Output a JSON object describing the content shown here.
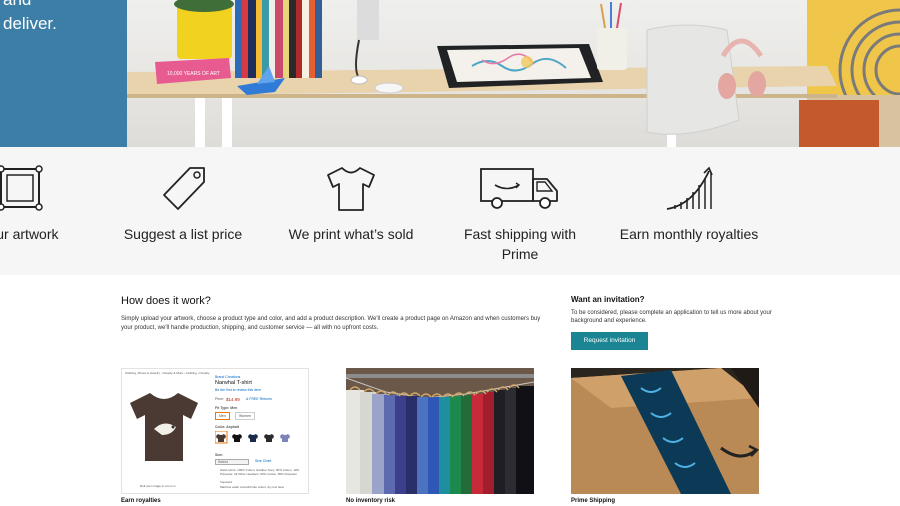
{
  "hero": {
    "text_lines": [
      "and",
      "deliver."
    ],
    "book_label": "10,000 YEARS OF ART"
  },
  "steps": [
    {
      "label": "your artwork",
      "icon": "frame-icon"
    },
    {
      "label": "Suggest a list price",
      "icon": "price-tag-icon"
    },
    {
      "label": "We print what’s sold",
      "icon": "tshirt-icon"
    },
    {
      "label_lines": [
        "Fast shipping with",
        "Prime"
      ],
      "icon": "delivery-truck-icon"
    },
    {
      "label": "Earn monthly royalties",
      "icon": "growth-chart-icon"
    }
  ],
  "how": {
    "title": "How does it work?",
    "description": "Simply upload your artwork, choose a product type and color, and add a product description. We'll create a product page on Amazon and when customers buy your product, we'll handle production, shipping, and customer service — all with no upfront costs."
  },
  "invitation": {
    "title": "Want an invitation?",
    "description": "To be considered, please complete an application to tell us more about your background and experience.",
    "button_label": "Request invitation"
  },
  "cards": [
    {
      "caption": "Earn royalties"
    },
    {
      "caption": "No inventory risk"
    },
    {
      "caption": "Prime Shipping"
    }
  ],
  "product_mock": {
    "breadcrumb": "Clothing, Shoes & Jewelry › Novelty & More › Clothing › Novelty",
    "brand": "Brand Creations",
    "title": "Narwhal T-shirt",
    "rating_text": "Be the first to review this item",
    "price_label": "Price:",
    "price": "$14.99",
    "shipping": "& FREE Returns",
    "fit_label": "Fit Type: Men",
    "fit_options": [
      "Men",
      "Women"
    ],
    "color_label": "Color: Asphalt",
    "size_label": "Size:",
    "size_select": "Select",
    "size_chart": "Size Chart",
    "bullets": [
      "Solid colors: 100% Cotton; Heather Grey: 90% Cotton, 10% Polyester; All Other Heathers: 50% Cotton, 50% Polyester",
      "Imported",
      "Machine wash cold with like colors, dry low heat"
    ],
    "zoom_hint": "Roll over image to zoom in"
  },
  "colors": {
    "hero_blue": "#3c7ea5",
    "button_teal": "#1b8593",
    "price_red": "#b12704",
    "link_blue": "#0066c0"
  }
}
